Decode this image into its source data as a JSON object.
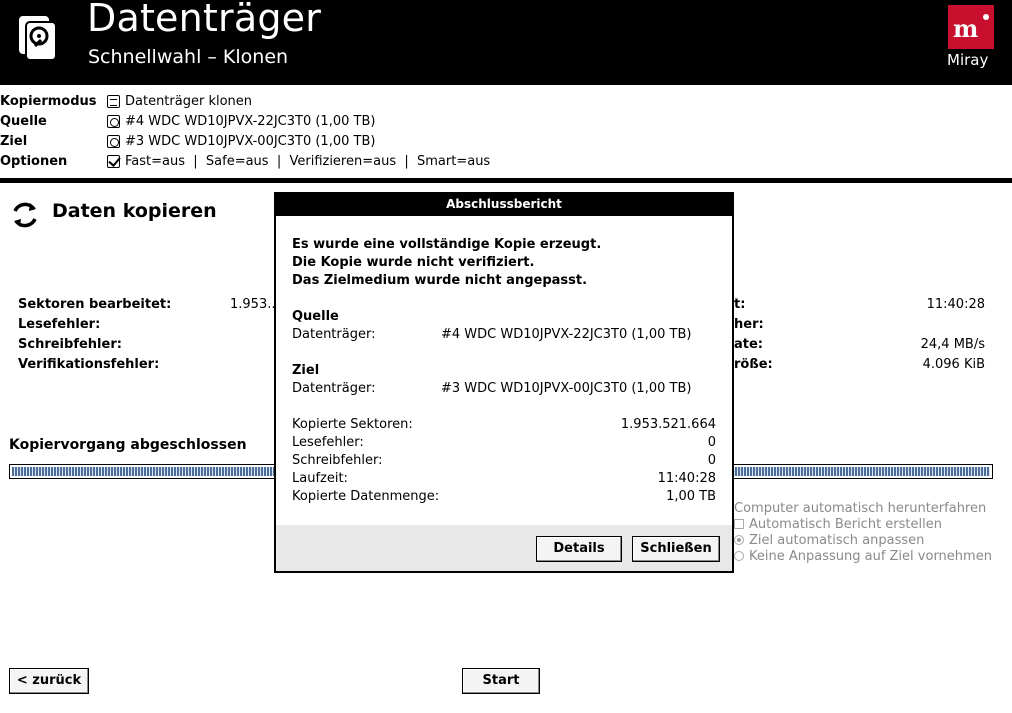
{
  "header": {
    "title": "Datenträger",
    "subtitle": "Schnellwahl – Klonen",
    "brand_name": "Miray",
    "brand_color": "#c8102e"
  },
  "info": {
    "rows": [
      {
        "label": "Kopiermodus",
        "icon": "clone-icon",
        "value": "Datenträger klonen"
      },
      {
        "label": "Quelle",
        "icon": "disk-icon",
        "value": "#4 WDC WD10JPVX-22JC3T0 (1,00 TB)"
      },
      {
        "label": "Ziel",
        "icon": "disk-icon",
        "value": "#3 WDC WD10JPVX-00JC3T0 (1,00 TB)"
      },
      {
        "label": "Optionen",
        "icon": "checkbox-icon",
        "value": "Fast=aus  |  Safe=aus  |  Verifizieren=aus  |  Smart=aus"
      }
    ]
  },
  "main": {
    "section_title": "Daten kopieren",
    "stats_left": [
      {
        "label": "Sektoren bearbeitet:",
        "value": "1.953.."
      },
      {
        "label": "Lesefehler:",
        "value": ""
      },
      {
        "label": "Schreibfehler:",
        "value": ""
      },
      {
        "label": "Verifikationsfehler:",
        "value": ""
      }
    ],
    "stats_right": [
      {
        "label": "t:",
        "value": "11:40:28"
      },
      {
        "label": "her:",
        "value": ""
      },
      {
        "label": "ate:",
        "value": "24,4 MB/s"
      },
      {
        "label": "röße:",
        "value": "4.096 KiB"
      }
    ],
    "progress_title": "Kopiervorgang abgeschlossen",
    "progress": 1.0,
    "options": [
      {
        "type": "none",
        "label": "Computer automatisch herunterfahren"
      },
      {
        "type": "checkbox",
        "label": "Automatisch Bericht erstellen",
        "checked": false
      },
      {
        "type": "radio",
        "label": "Ziel automatisch anpassen",
        "checked": true
      },
      {
        "type": "radio",
        "label": "Keine Anpassung auf Ziel vornehmen",
        "checked": false
      }
    ],
    "back_label": "< zurück",
    "start_label": "Start"
  },
  "dialog": {
    "title": "Abschlussbericht",
    "messages": [
      "Es wurde eine vollständige Kopie erzeugt.",
      "Die Kopie wurde nicht verifiziert.",
      "Das Zielmedium wurde nicht angepasst."
    ],
    "source_heading": "Quelle",
    "source_label": "Datenträger:",
    "source_value": "#4 WDC WD10JPVX-22JC3T0 (1,00 TB)",
    "target_heading": "Ziel",
    "target_label": "Datenträger:",
    "target_value": "#3 WDC WD10JPVX-00JC3T0 (1,00 TB)",
    "summary": [
      {
        "label": "Kopierte Sektoren:",
        "value": "1.953.521.664"
      },
      {
        "label": "Lesefehler:",
        "value": "0"
      },
      {
        "label": "Schreibfehler:",
        "value": "0"
      },
      {
        "label": "Laufzeit:",
        "value": "11:40:28"
      },
      {
        "label": "Kopierte Datenmenge:",
        "value": "1,00 TB"
      }
    ],
    "details_label": "Details",
    "close_label": "Schließen"
  }
}
